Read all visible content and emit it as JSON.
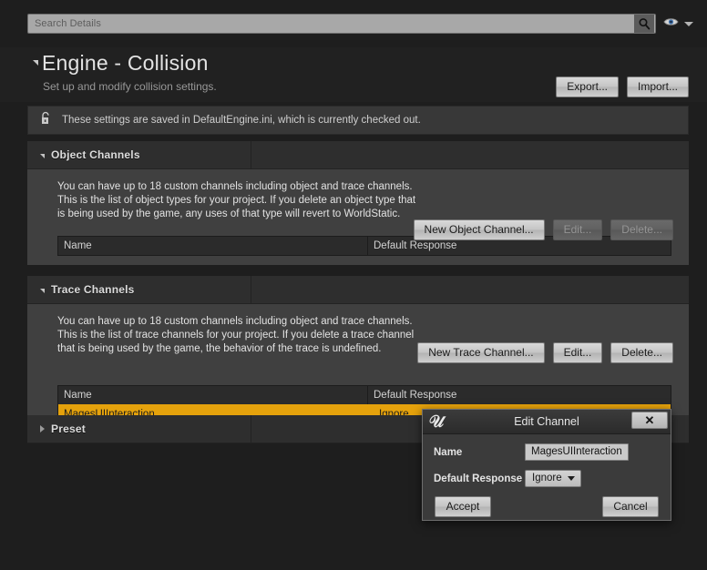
{
  "search": {
    "placeholder": "Search Details",
    "value": "",
    "search_icon": "magnifier-icon",
    "eye_icon": "eye-icon",
    "dropdown_icon": "chevron-down-icon"
  },
  "header": {
    "title": "Engine - Collision",
    "subtitle": "Set up and modify collision settings.",
    "export_label": "Export...",
    "import_label": "Import..."
  },
  "notice": {
    "icon": "unlock-icon",
    "text": "These settings are saved in DefaultEngine.ini, which is currently checked out."
  },
  "object_channels": {
    "title": "Object Channels",
    "expanded": true,
    "description": "You can have up to 18 custom channels including object and trace channels. This is the list of object types for your project. If you delete an object type that is being used by the game, any uses of that type will revert to WorldStatic.",
    "new_label": "New Object Channel...",
    "edit_label": "Edit...",
    "delete_label": "Delete...",
    "edit_enabled": false,
    "delete_enabled": false,
    "columns": [
      "Name",
      "Default Response"
    ],
    "rows": []
  },
  "trace_channels": {
    "title": "Trace Channels",
    "expanded": true,
    "description": "You can have up to 18 custom channels including object and trace channels. This is the list of trace channels for your project. If you delete a trace channel that is being used by the game, the behavior of the trace is undefined.",
    "new_label": "New Trace Channel...",
    "edit_label": "Edit...",
    "delete_label": "Delete...",
    "edit_enabled": true,
    "delete_enabled": true,
    "columns": [
      "Name",
      "Default Response"
    ],
    "rows": [
      {
        "name": "MagesUIInteraction",
        "response": "Ignore",
        "selected": true
      }
    ]
  },
  "preset": {
    "title": "Preset",
    "expanded": false
  },
  "dialog": {
    "title": "Edit Channel",
    "logo": "unreal-engine-logo",
    "close_label": "✕",
    "name_label": "Name",
    "name_value": "MagesUIInteraction",
    "response_label": "Default Response",
    "response_value": "Ignore",
    "accept_label": "Accept",
    "cancel_label": "Cancel"
  },
  "colors": {
    "selection_orange": "#e5a20c",
    "panel_bg": "#404040",
    "window_bg": "#1e1e1e",
    "section_header": "#2e2e2e"
  }
}
